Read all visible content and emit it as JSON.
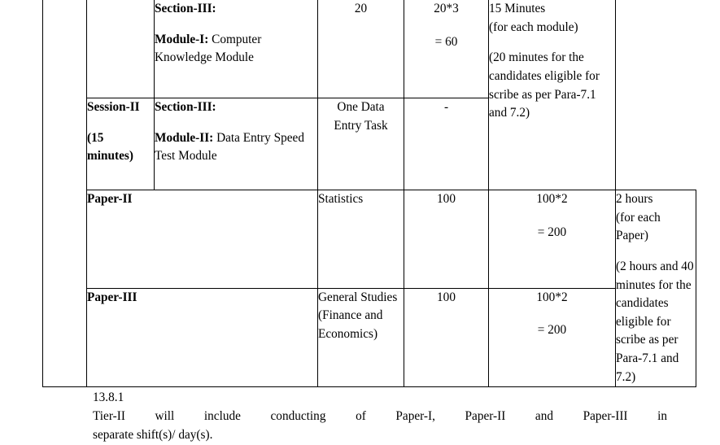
{
  "table": {
    "rows": [
      {
        "name": "module-i-row",
        "session": "",
        "section_heading": "Section-III:",
        "module_label": "Module-I:",
        "module_text": "Computer Knowledge Module",
        "questions": "20",
        "marks_line1": "20*3",
        "marks_line2": "= 60",
        "time_lines": [
          "15 Minutes",
          "(for each module)",
          "(20 minutes for the candidates eligible for scribe as per Para-7.1 and 7.2)"
        ]
      },
      {
        "name": "module-ii-row",
        "session_line1": "Session-II",
        "session_line2": "(15",
        "session_line3": "minutes)",
        "section_heading": "Section-III:",
        "module_label": "Module-II:",
        "module_text": "Data Entry Speed Test Module",
        "questions_line1": "One Data",
        "questions_line2": "Entry Task",
        "marks": "-"
      },
      {
        "name": "paper-ii-row",
        "paper_label": "Paper-II",
        "subject": "Statistics",
        "questions": "100",
        "marks_line1": "100*2",
        "marks_line2": "= 200",
        "time_lines": [
          "2 hours",
          "(for each Paper)",
          "(2 hours and 40 minutes for the candidates eligible for scribe as per Para-7.1 and 7.2)"
        ]
      },
      {
        "name": "paper-iii-row",
        "paper_label": "Paper-III",
        "subject": "General Studies (Finance and Economics)",
        "questions": "100",
        "marks_line1": "100*2",
        "marks_line2": "= 200"
      }
    ]
  },
  "clause": {
    "number": "13.8.1",
    "line1": "Tier-II will include conducting of Paper-I, Paper-II and Paper-III in",
    "line2": "separate shift(s)/ day(s)."
  }
}
